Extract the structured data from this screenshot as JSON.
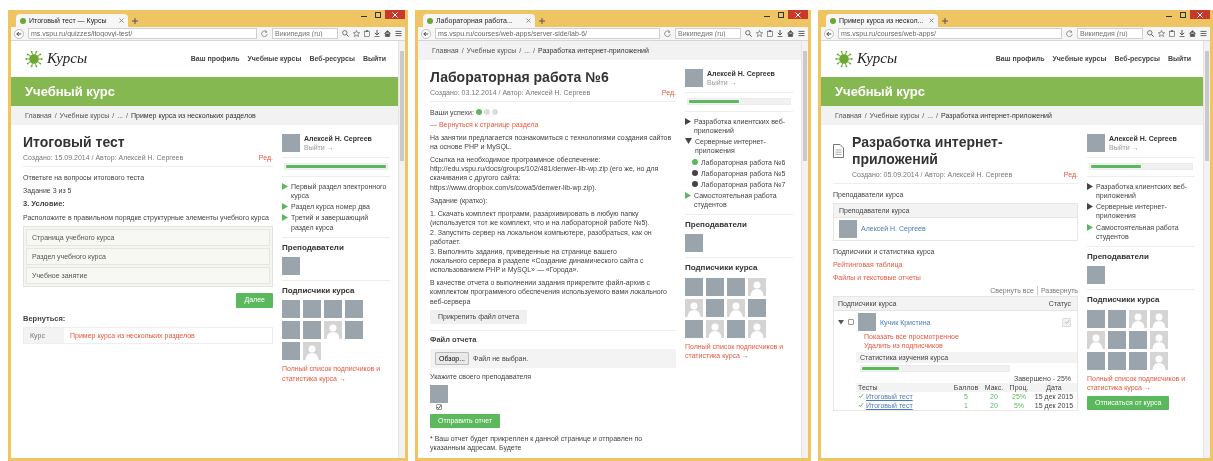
{
  "windows": [
    {
      "tab_title": "Итоговый тест — Курсы",
      "url": "ms.vspu.ru/quizzes/itogovyi-test/",
      "search_placeholder": "Википедия (ru)",
      "header": {
        "logo": "Курсы",
        "nav": [
          "Ваш профиль",
          "Учебные курсы",
          "Веб-ресурсы",
          "Выйти"
        ]
      },
      "banner": "Учебный курс",
      "breadcrumb": [
        {
          "kind": "link",
          "text": "Главная"
        },
        {
          "kind": "separator",
          "text": "/"
        },
        {
          "kind": "link",
          "text": "Учебные курсы"
        },
        {
          "kind": "separator",
          "text": "/"
        },
        {
          "kind": "link",
          "text": "..."
        },
        {
          "kind": "separator",
          "text": "/"
        },
        {
          "kind": "current",
          "text": "Пример курса из нескольких разделов"
        }
      ],
      "main": {
        "title": "Итоговый тест",
        "with_icon": false,
        "meta": "Создано: 15.09.2014 /  Автор: Алексей Н. Сергеев",
        "edit": "Ред.",
        "blocks": [
          {
            "kind": "paragraph",
            "text": "Ответьте на вопросы итогового теста"
          },
          {
            "kind": "paragraph",
            "text": "Задание 3 из 5"
          },
          {
            "kind": "heading",
            "text": "3. Условие:"
          },
          {
            "kind": "paragraph",
            "text": "Расположите в правильном порядке структурные элементы учебного курса"
          },
          {
            "kind": "sortable",
            "items": [
              "Страница учебного курса",
              "Раздел учебного курса",
              "Учебное занятие"
            ]
          },
          {
            "kind": "next_button",
            "text": "Далее"
          },
          {
            "kind": "heading",
            "text": "Вернуться:"
          },
          {
            "kind": "return_table",
            "label": "Курс",
            "link": "Пример курса из нескольких разделов"
          }
        ]
      },
      "sidebar": {
        "user": "Алексей Н. Сергеев",
        "logout": "Выйти →",
        "level": 1.0,
        "nav": [
          {
            "label": "Первый раздел электронного курса",
            "color": "#5cb85c"
          },
          {
            "label": "Раздел курса номер два",
            "color": "#5cb85c"
          },
          {
            "label": "Третий и завершающий раздел курса",
            "color": "#5cb85c"
          }
        ],
        "teachers_title": "Преподаватели",
        "teachers": [
          {
            "kind": "photo"
          }
        ],
        "subscribers_title": "Подписчики курса",
        "subscribers": [
          {
            "kind": "photo"
          },
          {
            "kind": "photo"
          },
          {
            "kind": "photo"
          },
          {
            "kind": "photo"
          },
          {
            "kind": "photo"
          },
          {
            "kind": "photo"
          },
          {
            "kind": "blank"
          },
          {
            "kind": "photo"
          },
          {
            "kind": "photo"
          },
          {
            "kind": "blank"
          }
        ],
        "full_list": "Полный список подписчиков и статистика курса →"
      }
    },
    {
      "tab_title": "Лабораторная работа...",
      "url": "ms.vspu.ru/courses/web-apps/server-side/lab-6/",
      "search_placeholder": "Википедия (ru)",
      "breadcrumb": [
        {
          "kind": "link",
          "text": "Главная"
        },
        {
          "kind": "separator",
          "text": "/"
        },
        {
          "kind": "link",
          "text": "Учебные курсы"
        },
        {
          "kind": "separator",
          "text": "/"
        },
        {
          "kind": "link",
          "text": "..."
        },
        {
          "kind": "separator",
          "text": "/"
        },
        {
          "kind": "current",
          "text": "Разработка интернет-приложений"
        }
      ],
      "main": {
        "title": "Лабораторная работа №6",
        "with_icon": false,
        "meta": "Создано: 03.12.2014 /  Автор: Алексей Н. Сергеев",
        "edit": "Ред.",
        "blocks": [
          {
            "kind": "progress_dots",
            "label": "Ваши успехи:",
            "dots": [
              {
                "done": true
              },
              {
                "done": false
              },
              {
                "done": false
              }
            ]
          },
          {
            "kind": "link",
            "text": "— Вернуться к странице раздела"
          },
          {
            "kind": "paragraph",
            "text": "На занятии предлагается познакомиться с технологиями создания сайтов на основе PHP и MySQL."
          },
          {
            "kind": "rich_paragraph",
            "parts": [
              {
                "kind": "text",
                "text": "Ссылка на необходимое программное обеспечение: "
              },
              {
                "kind": "link",
                "text": "http://edu.vspu.ru/docs/groups/102/481/denwer-lib-wp.zip"
              },
              {
                "kind": "text",
                "text": " (его же, но для скачивания с другого сайта: "
              },
              {
                "kind": "link",
                "text": "https://www.dropbox.com/s/cowa5/denwer-lib-wp.zip"
              },
              {
                "kind": "text",
                "text": ")."
              }
            ]
          },
          {
            "kind": "paragraph",
            "text": "Задание (кратко):"
          },
          {
            "kind": "list_item",
            "text": "1. Скачать комплект программ, разархивировать в любую папку (используется тот же комплект, что и на лабораторной работе №5)."
          },
          {
            "kind": "list_item",
            "text": "2. Запустить сервер на локальном компьютере, разобраться, как он работает."
          },
          {
            "kind": "rich_paragraph",
            "parts": [
              {
                "kind": "text",
                "text": "3. Выполнить задания, приведенные на странице вашего "
              },
              {
                "kind": "link",
                "text": "локального сервера"
              },
              {
                "kind": "text",
                "text": " в разделе «Создание динамического сайта с использованием PHP и MySQL» — "
              },
              {
                "kind": "link",
                "text": "«Города»"
              },
              {
                "kind": "text",
                "text": "."
              }
            ]
          },
          {
            "kind": "paragraph",
            "text": "В качестве отчета о выполнении задания прикрепите файл-архив с комплектом программного обеспечения используемого вами локального веб-сервера"
          },
          {
            "kind": "attach_button",
            "text": "Прикрепить файл отчета"
          },
          {
            "kind": "divider"
          },
          {
            "kind": "heading",
            "text": "Файл отчета"
          },
          {
            "kind": "file_field",
            "button": "Обзор...",
            "status": "Файл не выбран."
          },
          {
            "kind": "paragraph",
            "text": "Укажите своего преподавателя"
          },
          {
            "kind": "teacher_pick",
            "checked": true
          },
          {
            "kind": "send_button",
            "text": "Отправить отчет"
          },
          {
            "kind": "paragraph",
            "text": "* Ваш отчет будет прикреплен к данной странице и отправлен по указанным адресам. Будете"
          }
        ]
      },
      "sidebar": {
        "user": "Алексей Н. Сергеев",
        "logout": "Выйти →",
        "level": 0.5,
        "nav": [
          {
            "label": "Разработка клиентских веб-приложений",
            "color": "#444444",
            "expanded": false
          },
          {
            "label": "Серверные интернет-приложения",
            "color": "#444444",
            "expanded": true,
            "children": [
              {
                "label": "Лабораторная работа №6",
                "color": "#5cb85c"
              },
              {
                "label": "Лабораторная работа №5",
                "color": "#444444"
              },
              {
                "label": "Лабораторная работа №7",
                "color": "#444444"
              }
            ]
          },
          {
            "label": "Самостоятельная работа студентов",
            "color": "#5cb85c"
          }
        ],
        "teachers_title": "Преподаватели",
        "teachers": [
          {
            "kind": "photo"
          }
        ],
        "subscribers_title": "Подписчики курса",
        "subscribers": [
          {
            "kind": "photo"
          },
          {
            "kind": "photo"
          },
          {
            "kind": "photo"
          },
          {
            "kind": "blank"
          },
          {
            "kind": "blank"
          },
          {
            "kind": "photo"
          },
          {
            "kind": "blank"
          },
          {
            "kind": "photo"
          },
          {
            "kind": "photo"
          },
          {
            "kind": "blank"
          },
          {
            "kind": "photo"
          },
          {
            "kind": "blank"
          }
        ],
        "full_list": "Полный список подписчиков и статистика курса →"
      }
    },
    {
      "tab_title": "Пример курса из нескол...",
      "url": "ms.vspu.ru/courses/web-apps/",
      "search_placeholder": "Википедия (ru)",
      "header": {
        "logo": "Курсы",
        "nav": [
          "Ваш профиль",
          "Учебные курсы",
          "Веб-ресурсы",
          "Выйти"
        ]
      },
      "banner": "Учебный курс",
      "breadcrumb": [
        {
          "kind": "link",
          "text": "Главная"
        },
        {
          "kind": "separator",
          "text": "/"
        },
        {
          "kind": "link",
          "text": "Учебные курсы"
        },
        {
          "kind": "separator",
          "text": "/"
        },
        {
          "kind": "link",
          "text": "..."
        },
        {
          "kind": "separator",
          "text": "/"
        },
        {
          "kind": "current",
          "text": "Разработка интернет-приложений"
        }
      ],
      "main": {
        "title": "Разработка интернет-приложений",
        "with_icon": true,
        "meta": "Создано: 05.09.2014 /  Автор: Алексей Н. Сергеев",
        "edit": "Ред.",
        "blocks": [
          {
            "kind": "paragraph",
            "text": "Преподаватели курса"
          },
          {
            "kind": "teachers_panel",
            "header": "Преподаватели курса",
            "rows": [
              {
                "name": "Алексей Н. Сергеев"
              }
            ]
          },
          {
            "kind": "paragraph",
            "text": "Подписчики и статистика курса"
          },
          {
            "kind": "link",
            "text": "Рейтинговая таблица"
          },
          {
            "kind": "link",
            "text": "Файлы и текстовые отчеты"
          },
          {
            "kind": "subscribers_table",
            "tools": [
              "Свернуть все",
              "Развернуть"
            ],
            "columns": [
              "Подписчики курса",
              "Статус"
            ],
            "rows": [
              {
                "name": "Кучик Кристина",
                "expanded": true,
                "checked": false,
                "status_checked": true,
                "links": [
                  "Показать все просмотренное",
                  "Удалить из подписчиков"
                ],
                "stats": {
                  "title": "Статистика изучения курса",
                  "level": 0.25,
                  "done_text": "Завершено - 25%",
                  "columns": [
                    "Тесты",
                    "Баллов",
                    "Макс.",
                    "Проц.",
                    "Дата"
                  ],
                  "rows": [
                    {
                      "passed": true,
                      "cells": [
                        "Итоговый тест",
                        "5",
                        "20",
                        "25%",
                        "15 дек 2015"
                      ]
                    },
                    {
                      "passed": true,
                      "cells": [
                        "Итоговый тест",
                        "1",
                        "20",
                        "5%",
                        "15 дек 2015"
                      ]
                    }
                  ]
                }
              }
            ]
          }
        ]
      },
      "sidebar": {
        "user": "Алексей Н. Сергеев",
        "logout": "Выйти →",
        "level": 0.5,
        "nav": [
          {
            "label": "Разработка клиентских веб-приложений",
            "color": "#444444"
          },
          {
            "label": "Серверные интернет-приложения",
            "color": "#444444"
          },
          {
            "label": "Самостоятельная работа студентов",
            "color": "#5cb85c"
          }
        ],
        "teachers_title": "Преподаватели",
        "teachers": [
          {
            "kind": "photo"
          }
        ],
        "subscribers_title": "Подписчики курса",
        "subscribers": [
          {
            "kind": "photo"
          },
          {
            "kind": "photo"
          },
          {
            "kind": "blank"
          },
          {
            "kind": "blank"
          },
          {
            "kind": "blank"
          },
          {
            "kind": "photo"
          },
          {
            "kind": "photo"
          },
          {
            "kind": "blank"
          },
          {
            "kind": "photo"
          },
          {
            "kind": "photo"
          },
          {
            "kind": "photo"
          },
          {
            "kind": "blank"
          }
        ],
        "full_list": "Полный список подписчиков и статистика курса →",
        "unsubscribe": "Отписаться от курса"
      }
    }
  ]
}
